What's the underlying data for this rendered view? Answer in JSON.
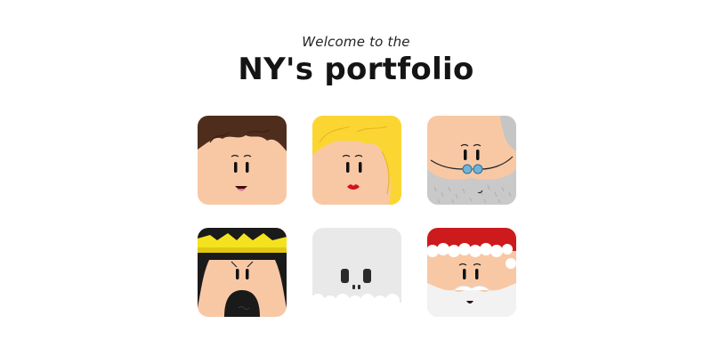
{
  "header": {
    "welcome": "Welcome to the",
    "title": "NY's portfolio"
  },
  "colors": {
    "skin": "#f8c8a5",
    "brown_hair": "#4e2d1c",
    "blonde_hair": "#fbd633",
    "gray_hair": "#c5c5c5",
    "crown_gold": "#f4e21f",
    "santa_red": "#cc1a1d",
    "beard_white": "#f2f2f2"
  },
  "avatars": [
    {
      "id": "boy",
      "icon": "brown-hair-face-icon"
    },
    {
      "id": "girl",
      "icon": "blonde-woman-face-icon"
    },
    {
      "id": "grandpa",
      "icon": "old-man-glasses-face-icon"
    },
    {
      "id": "king",
      "icon": "crowned-king-face-icon"
    },
    {
      "id": "ghost",
      "icon": "ghost-face-icon"
    },
    {
      "id": "santa",
      "icon": "santa-face-icon"
    }
  ]
}
